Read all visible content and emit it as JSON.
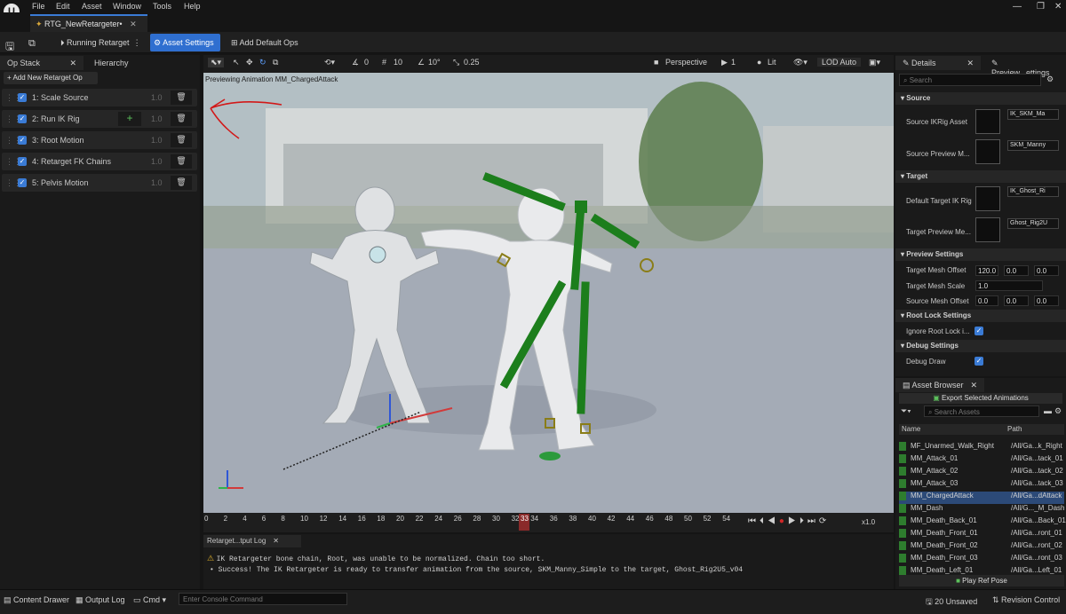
{
  "menu": [
    "File",
    "Edit",
    "Asset",
    "Window",
    "Tools",
    "Help"
  ],
  "document_tab": "RTG_NewRetargeter•",
  "toolbar": {
    "running": "Running Retarget",
    "asset_settings": "Asset Settings",
    "add_default_ops": "Add Default Ops"
  },
  "left_panel": {
    "tabs": [
      "Op Stack",
      "Hierarchy"
    ],
    "add_button": "+ Add New Retarget Op",
    "ops": [
      {
        "label": "1:  Scale Source",
        "weight": "1.0"
      },
      {
        "label": "2:  Run IK Rig",
        "weight": "1.0"
      },
      {
        "label": "3:  Root Motion",
        "weight": "1.0"
      },
      {
        "label": "4:  Retarget FK Chains",
        "weight": "1.0"
      },
      {
        "label": "5:  Pelvis Motion",
        "weight": "1.0"
      }
    ]
  },
  "viewport": {
    "toolbar": {
      "snap_rot": "0",
      "snap_loc": "10",
      "snap_angle": "10°",
      "snap_scale": "0.25",
      "perspective": "Perspective",
      "cam_speed": "1",
      "lit": "Lit",
      "lod": "LOD Auto"
    },
    "preview_text": "Previewing Animation MM_ChargedAttack"
  },
  "timeline": {
    "ticks": [
      "0",
      "2",
      "4",
      "6",
      "8",
      "10",
      "12",
      "14",
      "16",
      "18",
      "20",
      "22",
      "24",
      "26",
      "28",
      "30",
      "32",
      "34",
      "36",
      "38",
      "40",
      "42",
      "44",
      "46",
      "48",
      "50",
      "52",
      "54"
    ],
    "playhead": "33",
    "speed": "x1.0"
  },
  "log": {
    "tab": "Retarget...tput Log",
    "lines": [
      "IK Retargeter bone chain, Root, was unable to be normalized. Chain too short.",
      "• Success! The IK Retargeter is ready to transfer animation from the source, SKM_Manny_Simple to the target, Ghost_Rig2U5_v04"
    ]
  },
  "details": {
    "tabs": [
      "Details",
      "Preview...ettings"
    ],
    "search_placeholder": "Search",
    "sections": {
      "source": "Source",
      "target": "Target",
      "preview": "Preview Settings",
      "root_lock": "Root Lock Settings",
      "debug": "Debug Settings"
    },
    "source_ikrig_label": "Source IKRig Asset",
    "source_ikrig_value": "IK_SKM_Ma",
    "source_mesh_label": "Source Preview M...",
    "source_mesh_value": "SKM_Manny",
    "target_ikrig_label": "Default Target IK Rig",
    "target_ikrig_value": "IK_Ghost_Ri",
    "target_mesh_label": "Target Preview Me...",
    "target_mesh_value": "Ghost_Rig2U",
    "target_offset_label": "Target Mesh Offset",
    "target_offset": [
      "120.0",
      "0.0",
      "0.0"
    ],
    "target_scale_label": "Target Mesh Scale",
    "target_scale": "1.0",
    "source_offset_label": "Source Mesh Offset",
    "source_offset": [
      "0.0",
      "0.0",
      "0.0"
    ],
    "ignore_root_lock_label": "Ignore Root Lock i...",
    "debug_draw_label": "Debug Draw"
  },
  "asset_browser": {
    "tab": "Asset Browser",
    "export_button": "Export Selected Animations",
    "search_placeholder": "Search Assets",
    "col_name": "Name",
    "col_path": "Path",
    "rows": [
      {
        "name": "MF_Unarmed_Walk_Right",
        "path": "/All/Ga...k_Right"
      },
      {
        "name": "MM_Attack_01",
        "path": "/All/Ga...tack_01"
      },
      {
        "name": "MM_Attack_02",
        "path": "/All/Ga...tack_02"
      },
      {
        "name": "MM_Attack_03",
        "path": "/All/Ga...tack_03"
      },
      {
        "name": "MM_ChargedAttack",
        "path": "/All/Ga...dAttack"
      },
      {
        "name": "MM_Dash",
        "path": "/All/G..._M_Dash"
      },
      {
        "name": "MM_Death_Back_01",
        "path": "/All/Ga...Back_01"
      },
      {
        "name": "MM_Death_Front_01",
        "path": "/All/Ga...ront_01"
      },
      {
        "name": "MM_Death_Front_02",
        "path": "/All/Ga...ront_02"
      },
      {
        "name": "MM_Death_Front_03",
        "path": "/All/Ga...ront_03"
      },
      {
        "name": "MM_Death_Left_01",
        "path": "/All/Ga...Left_01"
      }
    ],
    "selected_index": 4,
    "play_ref_pose": "Play Ref Pose"
  },
  "status_bar": {
    "content_drawer": "Content Drawer",
    "output_log": "Output Log",
    "cmd": "Cmd",
    "console_placeholder": "Enter Console Command",
    "unsaved": "20 Unsaved",
    "revision": "Revision Control"
  },
  "colors": {
    "accent": "#2f6fd0",
    "debug_green": "#1a7a1a",
    "selected_row": "#2c4a78"
  }
}
